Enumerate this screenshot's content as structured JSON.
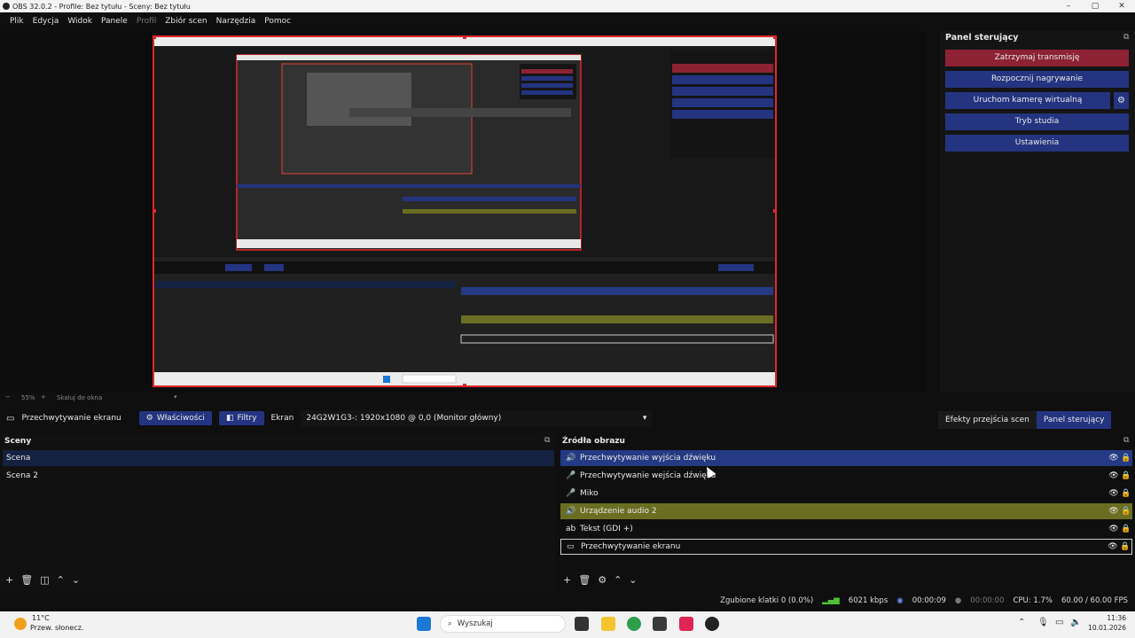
{
  "window": {
    "title": "OBS 32.0.2 - Profile: Bez tytułu - Sceny: Bez tytułu"
  },
  "menu": [
    "Plik",
    "Edycja",
    "Widok",
    "Panele",
    "Profil",
    "Zbiór scen",
    "Narzędzia",
    "Pomoc"
  ],
  "zoom": {
    "percent": "55%",
    "mode": "Skaluj do okna"
  },
  "control_panel": {
    "title": "Panel sterujący",
    "buttons": [
      "Zatrzymaj transmisję",
      "Rozpocznij nagrywanie",
      "Uruchom kamerę wirtualną",
      "Tryb studia",
      "Ustawienia"
    ]
  },
  "source_toolbar": {
    "source": "Przechwytywanie ekranu",
    "properties": "Właściwości",
    "filters": "Filtry",
    "screen_label": "Ekran",
    "screen_value": "24G2W1G3-: 1920x1080 @ 0,0 (Monitor główny)"
  },
  "right_tabs": [
    "Efekty przejścia scen",
    "Panel sterujący"
  ],
  "scenes": {
    "title": "Sceny",
    "items": [
      "Scena",
      "Scena 2"
    ]
  },
  "sources": {
    "title": "Źródła obrazu",
    "items": [
      {
        "label": "Przechwytywanie wyjścia dźwięku",
        "icon": "speaker-icon",
        "style": "blue"
      },
      {
        "label": "Przechwytywanie wejścia dźwięku",
        "icon": "mic-icon",
        "style": "none"
      },
      {
        "label": "Miko",
        "icon": "mic-icon",
        "style": "none"
      },
      {
        "label": "Urządzenie audio 2",
        "icon": "speaker-icon",
        "style": "green"
      },
      {
        "label": "Tekst (GDI +)",
        "icon": "text-icon",
        "style": "none"
      },
      {
        "label": "Przechwytywanie ekranu",
        "icon": "monitor-icon",
        "style": "outlined"
      }
    ]
  },
  "status": {
    "dropped": "Zgubione klatki 0 (0.0%)",
    "bitrate": "6021 kbps",
    "stream_time": "00:00:09",
    "rec_time": "00:00:00",
    "cpu": "CPU: 1.7%",
    "fps": "60.00 / 60.00 FPS"
  },
  "taskbar": {
    "temp": "11°C",
    "weather": "Przew. słonecz.",
    "search": "Wyszukaj",
    "time": "11:36",
    "date": "10.01.2026"
  },
  "colors": {
    "accent_blue": "#243480",
    "stop_red": "#8c2233",
    "audio_green": "#6b6e22",
    "canvas_border": "#e0262e"
  }
}
